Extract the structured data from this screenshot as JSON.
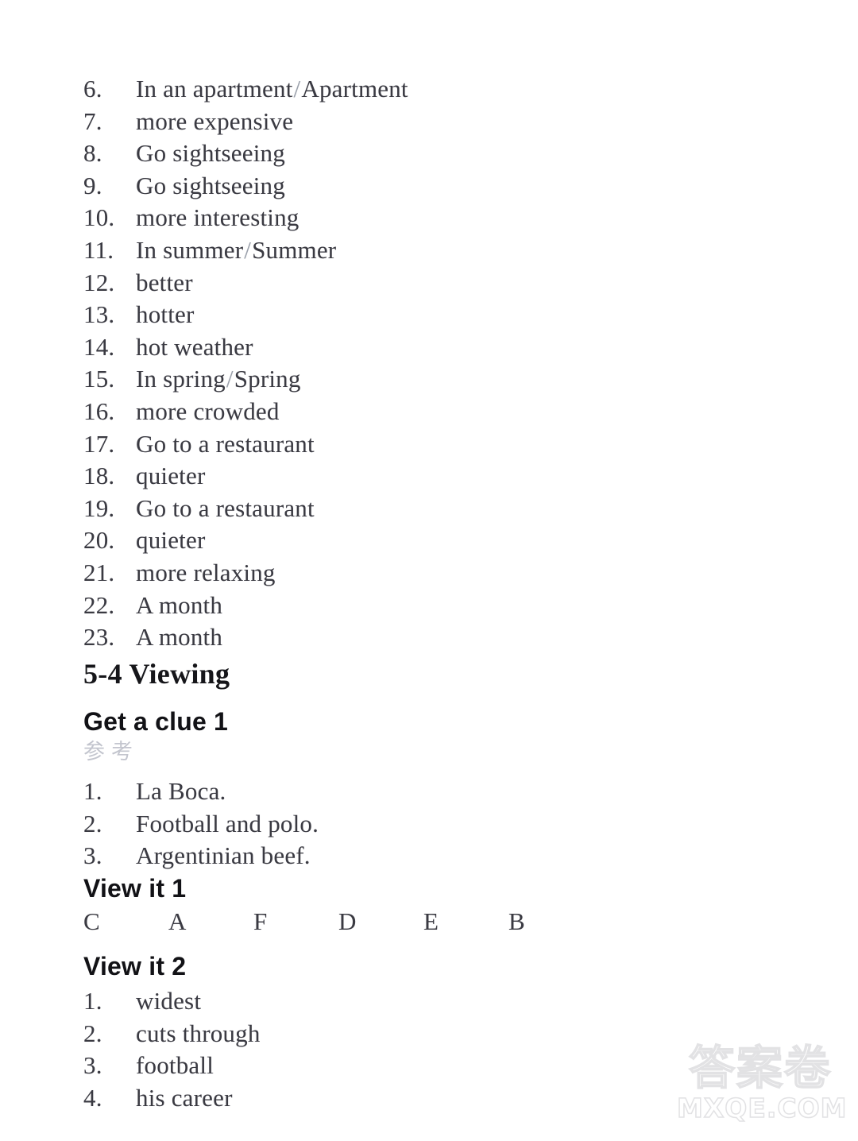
{
  "document": {
    "background_color": "#ffffff",
    "ink_color": "#35353c"
  },
  "main_answers": {
    "items": [
      {
        "number": "6.",
        "text": "In an apartment/Apartment"
      },
      {
        "number": "7.",
        "text": "more expensive"
      },
      {
        "number": "8.",
        "text": "Go sightseeing"
      },
      {
        "number": "9.",
        "text": "Go sightseeing"
      },
      {
        "number": "10.",
        "text": "more interesting"
      },
      {
        "number": "11.",
        "text": "In summer/Summer"
      },
      {
        "number": "12.",
        "text": "better"
      },
      {
        "number": "13.",
        "text": "hotter"
      },
      {
        "number": "14.",
        "text": "hot weather"
      },
      {
        "number": "15.",
        "text": "In spring/Spring"
      },
      {
        "number": "16.",
        "text": "more crowded"
      },
      {
        "number": "17.",
        "text": "Go to a restaurant"
      },
      {
        "number": "18.",
        "text": "quieter"
      },
      {
        "number": "19.",
        "text": "Go to a restaurant"
      },
      {
        "number": "20.",
        "text": "quieter"
      },
      {
        "number": "21.",
        "text": "more relaxing"
      },
      {
        "number": "22.",
        "text": "A month"
      },
      {
        "number": "23.",
        "text": "A month"
      }
    ]
  },
  "section": {
    "title": "5-4 Viewing"
  },
  "get_a_clue": {
    "heading": "Get a clue 1",
    "note": "参考",
    "items": [
      {
        "number": "1.",
        "text": "La Boca."
      },
      {
        "number": "2.",
        "text": "Football and polo."
      },
      {
        "number": "3.",
        "text": "Argentinian beef."
      }
    ]
  },
  "view_it_1": {
    "heading": "View it 1",
    "letters": [
      "C",
      "A",
      "F",
      "D",
      "E",
      "B"
    ]
  },
  "view_it_2": {
    "heading": "View it 2",
    "items": [
      {
        "number": "1.",
        "text": "widest"
      },
      {
        "number": "2.",
        "text": "cuts through"
      },
      {
        "number": "3.",
        "text": "football"
      },
      {
        "number": "4.",
        "text": "his career"
      }
    ]
  },
  "watermark": {
    "cjk": "答案卷",
    "domain": "MXQE.COM",
    "color": "#e2e2e4"
  }
}
